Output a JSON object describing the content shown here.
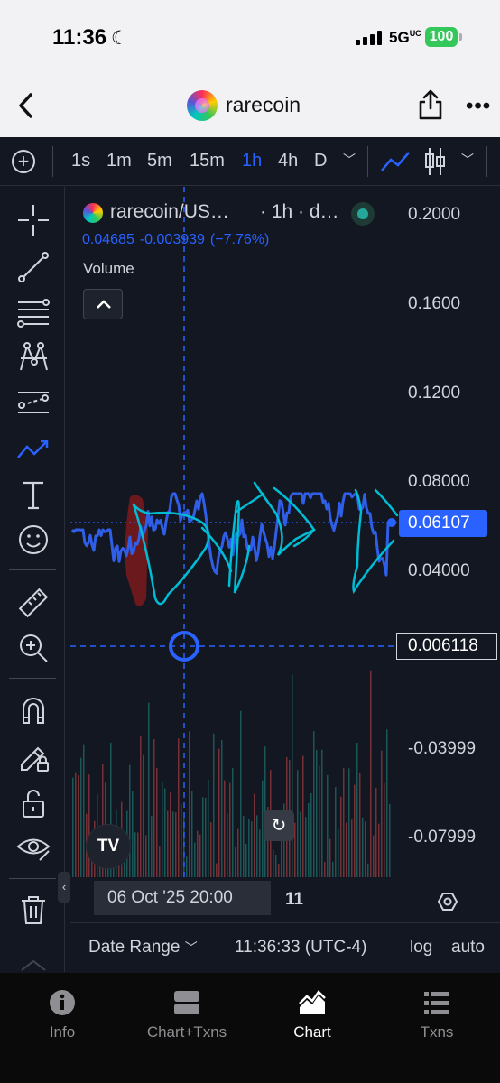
{
  "status_bar": {
    "time": "11:36",
    "network": "5G",
    "network_suffix": "UC",
    "battery": "100"
  },
  "header": {
    "title": "rarecoin"
  },
  "toolbar": {
    "intervals": [
      "1s",
      "1m",
      "5m",
      "15m",
      "1h",
      "4h",
      "D"
    ],
    "active_interval": "1h"
  },
  "legend": {
    "symbol": "rarecoin/US…",
    "interval_info": "· 1h · d…",
    "close": "0.04685",
    "change": "-0.003939",
    "change_pct": "(−7.76%)",
    "volume_label": "Volume"
  },
  "price_axis": {
    "labels": [
      "0.2000",
      "0.1600",
      "0.1200",
      "0.08000",
      "0.04000",
      "-0.03999",
      "-0.07999"
    ],
    "last_price": "0.06107",
    "crosshair_price": "0.006118"
  },
  "time_axis": {
    "crosshair_time": "06 Oct '25   20:00",
    "tick": "11"
  },
  "chart_footer": {
    "date_range": "Date Range",
    "clock": "11:36:33 (UTC-4)",
    "log": "log",
    "auto": "auto"
  },
  "colors": {
    "accent": "#2962ff",
    "price_line": "#2f5fe8",
    "drawing": "#00bcd4",
    "highlight": "#b71c1c",
    "background": "#131722"
  },
  "tabs": [
    {
      "label": "Info",
      "icon": "info-icon"
    },
    {
      "label": "Chart+Txns",
      "icon": "split-view-icon"
    },
    {
      "label": "Chart",
      "icon": "chart-icon",
      "active": true
    },
    {
      "label": "Txns",
      "icon": "list-icon"
    }
  ]
}
